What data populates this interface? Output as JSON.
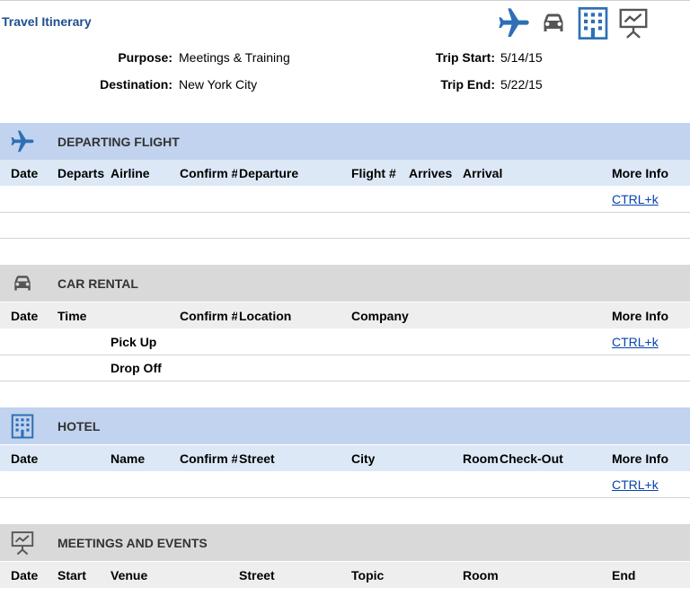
{
  "title": "Travel Itinerary",
  "header_icons": [
    "airplane-icon",
    "car-icon",
    "building-icon",
    "presentation-icon"
  ],
  "colors": {
    "accent": "#1f4e8c",
    "icon_blue": "#2e6fb6",
    "icon_gray": "#555555",
    "link": "#0645ad"
  },
  "trip": {
    "purpose_label": "Purpose:",
    "purpose": "Meetings & Training",
    "destination_label": "Destination:",
    "destination": "New York City",
    "start_label": "Trip Start:",
    "start": "5/14/15",
    "end_label": "Trip End:",
    "end": "5/22/15"
  },
  "flight": {
    "title": "DEPARTING FLIGHT",
    "columns": [
      "Date",
      "Departs",
      "Airline",
      "Confirm #",
      "Departure",
      "Flight #",
      "Arrives",
      "Arrival",
      "More Info"
    ],
    "link": "CTRL+k"
  },
  "car": {
    "title": "CAR RENTAL",
    "columns": [
      "Date",
      "Time",
      "Confirm #",
      "Location",
      "Company",
      "More Info"
    ],
    "pickup": "Pick Up",
    "dropoff": "Drop Off",
    "link": "CTRL+k"
  },
  "hotel": {
    "title": "HOTEL",
    "columns": [
      "Date",
      "Name",
      "Confirm #",
      "Street",
      "City",
      "Room",
      "Check-Out",
      "More Info"
    ],
    "link": "CTRL+k"
  },
  "meetings": {
    "title": "MEETINGS AND EVENTS",
    "columns": [
      "Date",
      "Start",
      "Venue",
      "Street",
      "Topic",
      "Room",
      "End"
    ]
  }
}
